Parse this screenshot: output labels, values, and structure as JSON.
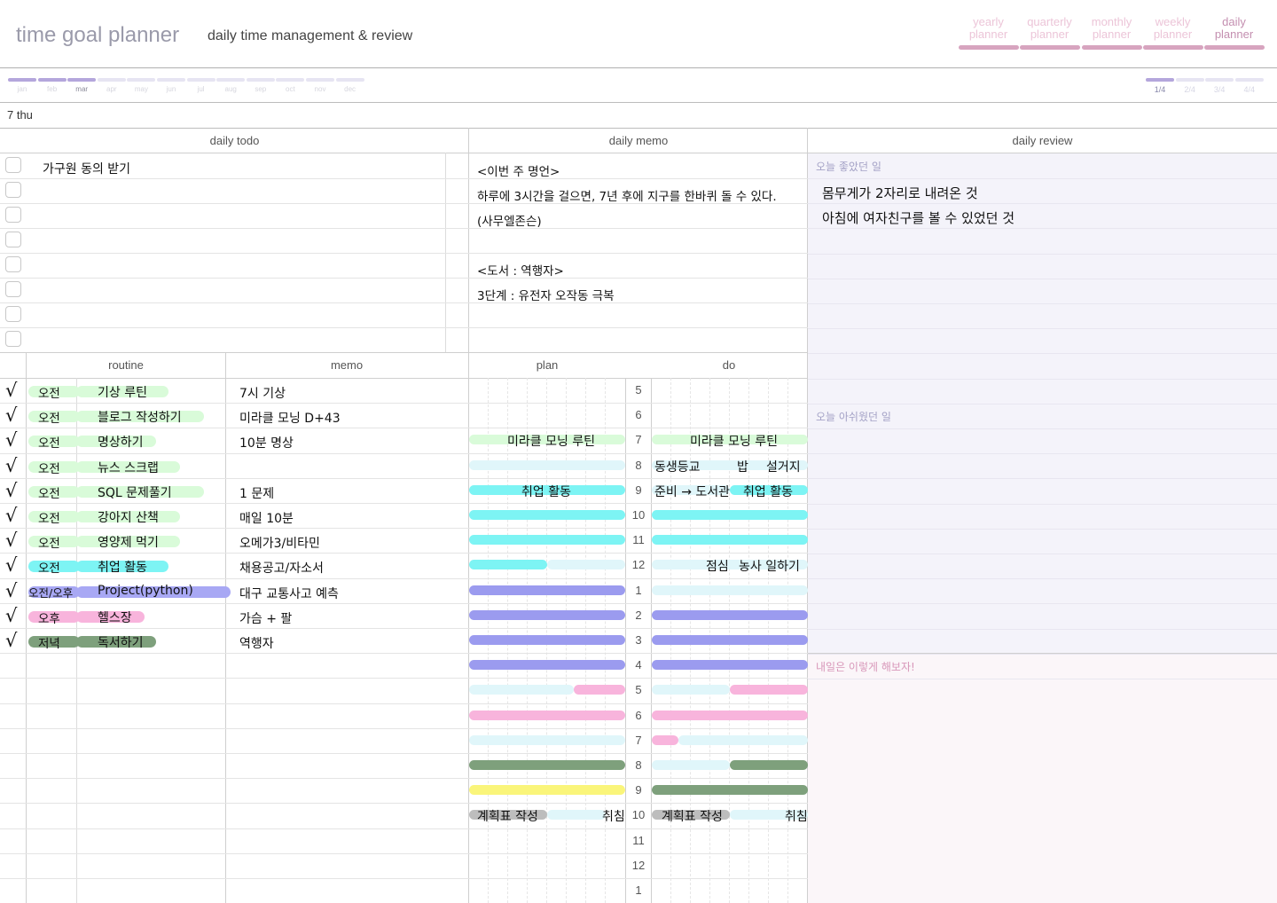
{
  "header": {
    "brand": "time goal planner",
    "subtitle": "daily time management & review",
    "nav": [
      {
        "line1": "yearly",
        "line2": "planner"
      },
      {
        "line1": "quarterly",
        "line2": "planner"
      },
      {
        "line1": "monthly",
        "line2": "planner"
      },
      {
        "line1": "weekly",
        "line2": "planner"
      },
      {
        "line1": "daily",
        "line2": "planner"
      }
    ],
    "active_nav": "daily"
  },
  "months": [
    "jan",
    "feb",
    "mar",
    "apr",
    "may",
    "jun",
    "jul",
    "aug",
    "sep",
    "oct",
    "nov",
    "dec"
  ],
  "current_month": "mar",
  "quarters": [
    "1/4",
    "2/4",
    "3/4",
    "4/4"
  ],
  "current_quarter": "1/4",
  "date": "7  thu",
  "sections": {
    "todo": "daily todo",
    "memo": "daily memo",
    "review": "daily review",
    "routine": "routine",
    "routine_memo": "memo",
    "plan": "plan",
    "do": "do"
  },
  "todos": [
    "가구원 동의 받기",
    "",
    "",
    "",
    "",
    "",
    "",
    ""
  ],
  "memo_lines": [
    "<이번 주 명언>",
    "하루에 3시간을 걸으면, 7년 후에 지구를  한바퀴 돌 수 있다.",
    "(사무엘존슨)",
    "",
    "<도서 : 역행자>",
    "3단계 : 유전자 오작동 극복",
    ""
  ],
  "review": {
    "good_label": "오늘 좋았던 일",
    "good": [
      "몸무게가 2자리로 내려온 것",
      "아침에 여자친구를 볼 수 있었던 것"
    ],
    "regret_label": "오늘 아쉬웠던 일",
    "tomorrow_label": "내일은 이렇게 해보자!"
  },
  "routines": [
    {
      "checked": true,
      "time": "오전",
      "task": "기상 루틴",
      "memo": "7시 기상",
      "color": "#d9fbd9"
    },
    {
      "checked": true,
      "time": "오전",
      "task": "블로그 작성하기",
      "memo": "미라클 모닝 D+43",
      "color": "#d9fbd9"
    },
    {
      "checked": true,
      "time": "오전",
      "task": "명상하기",
      "memo": "10분 명상",
      "color": "#d9fbd9"
    },
    {
      "checked": true,
      "time": "오전",
      "task": "뉴스 스크랩",
      "memo": "",
      "color": "#d9fbd9"
    },
    {
      "checked": true,
      "time": "오전",
      "task": "SQL 문제풀기",
      "memo": "1 문제",
      "color": "#d9fbd9"
    },
    {
      "checked": true,
      "time": "오전",
      "task": "강아지 산책",
      "memo": "매일 10분",
      "color": "#d9fbd9"
    },
    {
      "checked": true,
      "time": "오전",
      "task": "영양제 먹기",
      "memo": "오메가3/비타민",
      "color": "#d9fbd9"
    },
    {
      "checked": true,
      "time": "오전",
      "task": "취업 활동",
      "memo": "채용공고/자소서",
      "color": "#7df4f4"
    },
    {
      "checked": true,
      "time": "오전/오후",
      "task": "Project(python)",
      "memo": "대구 교통사고 예측",
      "color": "#a8a8f4"
    },
    {
      "checked": true,
      "time": "오후",
      "task": "헬스장",
      "memo": "가슴 + 팔",
      "color": "#f8b4dc"
    },
    {
      "checked": true,
      "time": "저녁",
      "task": "독서하기",
      "memo": "역행자",
      "color": "#7ea07c"
    }
  ],
  "hours": [
    "5",
    "6",
    "7",
    "8",
    "9",
    "10",
    "11",
    "12",
    "1",
    "2",
    "3",
    "4",
    "5",
    "6",
    "7",
    "8",
    "9",
    "10",
    "11",
    "12",
    "1"
  ],
  "plan_labels": {
    "r7": "미라클 모닝 루틴",
    "r9": "취업 활동",
    "r22a": "계획표 작성",
    "r22b": "취침"
  },
  "do_labels": {
    "r7": "미라클 모닝 루틴",
    "r8a": "동생등교",
    "r8b": "밥",
    "r8c": "설거지",
    "r9a": "준비 → 도서관",
    "r9b": "취업 활동",
    "r12a": "점심",
    "r12b": "농사 일하기",
    "r22a": "계획표 작성",
    "r22b": "취침"
  },
  "colors": {
    "accent": "#c48fb0",
    "routine_green": "#d9fbd9",
    "job_cyan": "#7df4f4",
    "light_cyan": "#e0f6fa",
    "project_purple": "#9b9bef",
    "gym_pink": "#f8b4dc",
    "reading_green": "#7ea07c",
    "yellow": "#faf57a",
    "gray": "#bdbdbd"
  }
}
